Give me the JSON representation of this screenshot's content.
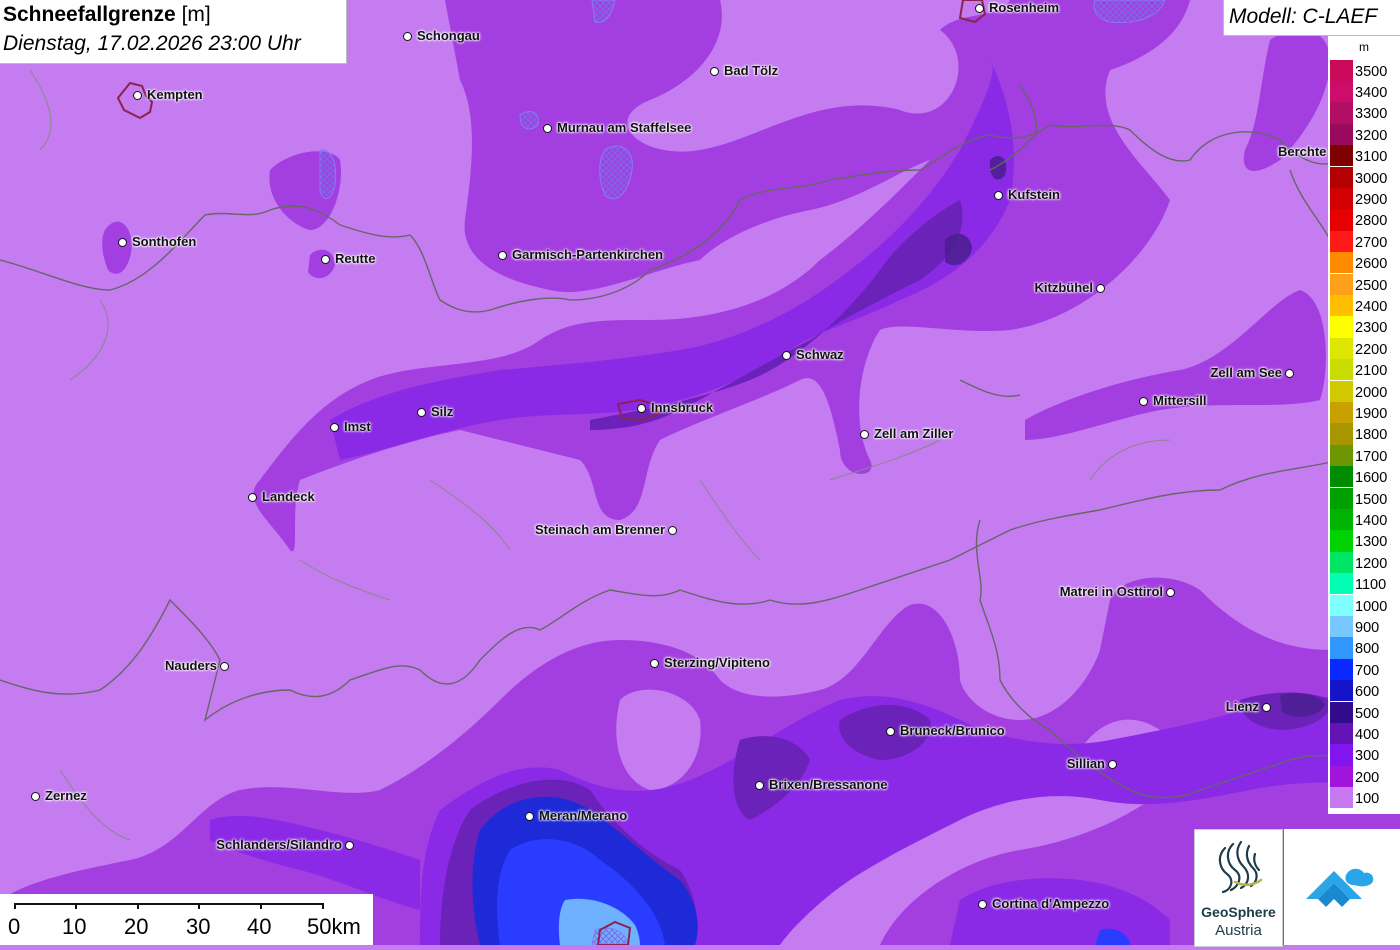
{
  "title": {
    "main": "Schneefallgrenze",
    "unit": "[m]",
    "datetime": "Dienstag, 17.02.2026 23:00 Uhr"
  },
  "model": "Modell: C-LAEF",
  "legend": {
    "unit": "m",
    "entries": [
      {
        "value": "3500",
        "color": "#cc0a5a"
      },
      {
        "value": "3400",
        "color": "#cd0c6b"
      },
      {
        "value": "3300",
        "color": "#b20e64"
      },
      {
        "value": "3200",
        "color": "#990a5f"
      },
      {
        "value": "3100",
        "color": "#7e0000"
      },
      {
        "value": "3000",
        "color": "#b40000"
      },
      {
        "value": "2900",
        "color": "#d20000"
      },
      {
        "value": "2800",
        "color": "#e60000"
      },
      {
        "value": "2700",
        "color": "#ff1a1a"
      },
      {
        "value": "2600",
        "color": "#ff8c00"
      },
      {
        "value": "2500",
        "color": "#ff9f1a"
      },
      {
        "value": "2400",
        "color": "#ffbf00"
      },
      {
        "value": "2300",
        "color": "#ffff00"
      },
      {
        "value": "2200",
        "color": "#dde600"
      },
      {
        "value": "2100",
        "color": "#c8dc00"
      },
      {
        "value": "2000",
        "color": "#d2c800"
      },
      {
        "value": "1900",
        "color": "#c8a000"
      },
      {
        "value": "1800",
        "color": "#a89600"
      },
      {
        "value": "1700",
        "color": "#6e9600"
      },
      {
        "value": "1600",
        "color": "#008c00"
      },
      {
        "value": "1500",
        "color": "#00a000"
      },
      {
        "value": "1400",
        "color": "#00b400"
      },
      {
        "value": "1300",
        "color": "#00d200"
      },
      {
        "value": "1200",
        "color": "#00e664"
      },
      {
        "value": "1100",
        "color": "#00ffb4"
      },
      {
        "value": "1000",
        "color": "#80ffff"
      },
      {
        "value": "900",
        "color": "#78c8ff"
      },
      {
        "value": "800",
        "color": "#3296ff"
      },
      {
        "value": "700",
        "color": "#0a28ff"
      },
      {
        "value": "600",
        "color": "#1414c8"
      },
      {
        "value": "500",
        "color": "#320a8c"
      },
      {
        "value": "400",
        "color": "#6414b4"
      },
      {
        "value": "300",
        "color": "#8214f0"
      },
      {
        "value": "200",
        "color": "#a014dc"
      },
      {
        "value": "100",
        "color": "#c878f0"
      }
    ]
  },
  "cities": [
    {
      "name": "Rosenheim",
      "label_side": "right"
    },
    {
      "name": "Schongau",
      "label_side": "right"
    },
    {
      "name": "Bad Tölz",
      "label_side": "right"
    },
    {
      "name": "Kempten",
      "label_side": "right"
    },
    {
      "name": "Murnau am Staffelsee",
      "label_side": "right"
    },
    {
      "name": "Berchte",
      "label_side": "right"
    },
    {
      "name": "Kufstein",
      "label_side": "right"
    },
    {
      "name": "Sonthofen",
      "label_side": "right"
    },
    {
      "name": "Reutte",
      "label_side": "right"
    },
    {
      "name": "Garmisch-Partenkirchen",
      "label_side": "right"
    },
    {
      "name": "Kitzbühel",
      "label_side": "left"
    },
    {
      "name": "Schwaz",
      "label_side": "right"
    },
    {
      "name": "Zell am See",
      "label_side": "left"
    },
    {
      "name": "Mittersill",
      "label_side": "right"
    },
    {
      "name": "Innsbruck",
      "label_side": "right"
    },
    {
      "name": "Silz",
      "label_side": "right"
    },
    {
      "name": "Imst",
      "label_side": "right"
    },
    {
      "name": "Zell am Ziller",
      "label_side": "right"
    },
    {
      "name": "Landeck",
      "label_side": "right"
    },
    {
      "name": "Steinach am Brenner",
      "label_side": "left"
    },
    {
      "name": "Matrei in Osttirol",
      "label_side": "left"
    },
    {
      "name": "Nauders",
      "label_side": "left"
    },
    {
      "name": "Sterzing/Vipiteno",
      "label_side": "right"
    },
    {
      "name": "Lienz",
      "label_side": "left"
    },
    {
      "name": "Bruneck/Brunico",
      "label_side": "right"
    },
    {
      "name": "Sillian",
      "label_side": "left"
    },
    {
      "name": "Brixen/Bressanone",
      "label_side": "right"
    },
    {
      "name": "Zernez",
      "label_side": "right"
    },
    {
      "name": "Meran/Merano",
      "label_side": "right"
    },
    {
      "name": "Schlanders/Silandro",
      "label_side": "left"
    },
    {
      "name": "Cortina d'Ampezzo",
      "label_side": "right"
    }
  ],
  "scale": {
    "labels": [
      "0",
      "10",
      "20",
      "30",
      "40",
      "50km"
    ]
  },
  "logos": {
    "geosphere_name": "GeoSphere",
    "geosphere_sub": "Austria"
  }
}
